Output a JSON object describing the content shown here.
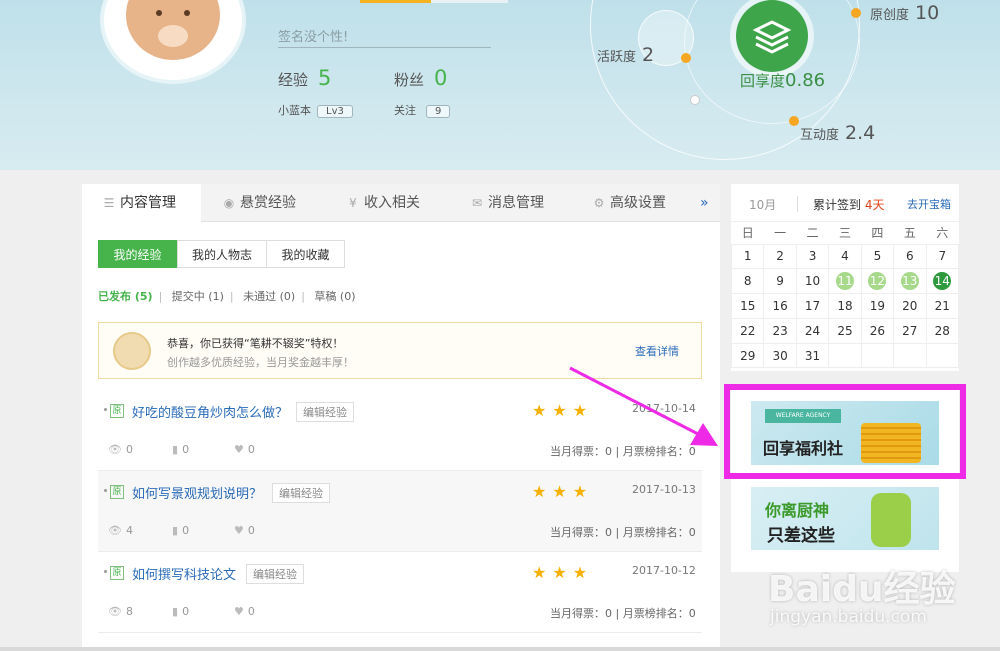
{
  "profile": {
    "signature_placeholder": "签名没个性!",
    "exp_label": "经验",
    "exp_value": "5",
    "fans_label": "粉丝",
    "fans_value": "0",
    "edition_label": "小蓝本",
    "edition_level": "Lv3",
    "follow_label": "关注",
    "follow_value": "9"
  },
  "metrics": {
    "activity_label": "活跃度",
    "activity_value": "2",
    "originality_label": "原创度",
    "originality_value": "10",
    "share_label": "回享度",
    "share_value": "0.86",
    "interaction_label": "互动度",
    "interaction_value": "2.4"
  },
  "tabs": [
    {
      "label": "内容管理",
      "icon": "list-icon"
    },
    {
      "label": "悬赏经验",
      "icon": "coin-icon"
    },
    {
      "label": "收入相关",
      "icon": "yen-icon"
    },
    {
      "label": "消息管理",
      "icon": "mail-icon"
    },
    {
      "label": "高级设置",
      "icon": "gear-icon"
    }
  ],
  "tabs_more": "»",
  "subtabs": [
    "我的经验",
    "我的人物志",
    "我的收藏"
  ],
  "filters": {
    "published": "已发布",
    "published_count": "(5)",
    "submitting": "提交中",
    "submitting_count": "(1)",
    "rejected": "未通过",
    "rejected_count": "(0)",
    "draft": "草稿",
    "draft_count": "(0)"
  },
  "notice": {
    "line1": "恭喜，你已获得“笔耕不辍奖”特权！",
    "line2": "创作越多优质经验，当月奖金越丰厚！",
    "link": "查看详情"
  },
  "articles": [
    {
      "badge": "原",
      "title": "好吃的酸豆角炒肉怎么做？",
      "edit": "编辑经验",
      "stars": "★★★",
      "date": "2017-10-14",
      "views": "0",
      "votes_icon": "0",
      "likes": "0",
      "votes": "当月得票：0 | 月票榜排名：0"
    },
    {
      "badge": "原",
      "title": "如何写景观规划说明？",
      "edit": "编辑经验",
      "stars": "★★★",
      "date": "2017-10-13",
      "views": "4",
      "votes_icon": "0",
      "likes": "0",
      "votes": "当月得票：0 | 月票榜排名：0"
    },
    {
      "badge": "原",
      "title": "如何撰写科技论文",
      "edit": "编辑经验",
      "stars": "★★★",
      "date": "2017-10-12",
      "views": "8",
      "votes_icon": "0",
      "likes": "0",
      "votes": "当月得票：0 | 月票榜排名：0"
    }
  ],
  "calendar": {
    "month": "10月",
    "signin_prefix": "累计签到",
    "signin_days": "4天",
    "open_box": "去开宝箱",
    "weekdays": [
      "日",
      "一",
      "二",
      "三",
      "四",
      "五",
      "六"
    ],
    "weeks": [
      [
        "1",
        "2",
        "3",
        "4",
        "5",
        "6",
        "7"
      ],
      [
        "8",
        "9",
        "10",
        "11",
        "12",
        "13",
        "14"
      ],
      [
        "15",
        "16",
        "17",
        "18",
        "19",
        "20",
        "21"
      ],
      [
        "22",
        "23",
        "24",
        "25",
        "26",
        "27",
        "28"
      ],
      [
        "29",
        "30",
        "31",
        "",
        "",
        "",
        ""
      ]
    ],
    "signed_days": [
      "11",
      "12",
      "13"
    ],
    "today": "14"
  },
  "ads": {
    "ad1_tag": "WELFARE AGENCY",
    "ad1_text": "回享福利社",
    "ad2_line1": "你离厨神",
    "ad2_line2": "只差这些"
  },
  "watermark": {
    "logo": "Baidu经验",
    "url": "jingyan.baidu.com"
  },
  "colors": {
    "accent_green": "#46b34b",
    "link_blue": "#2a6bb8",
    "highlight_magenta": "#ee2ae7",
    "star_gold": "#f5b000"
  }
}
